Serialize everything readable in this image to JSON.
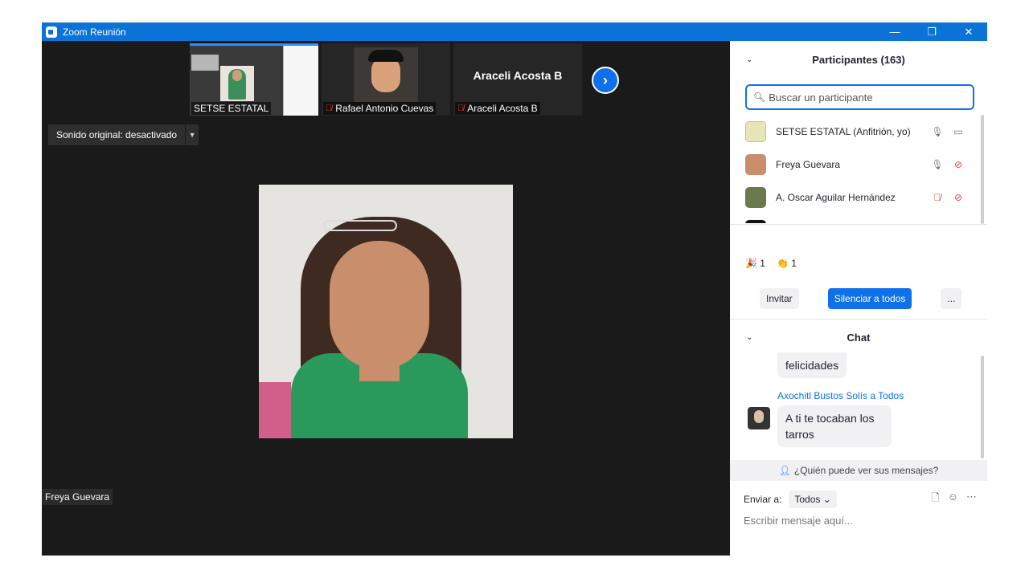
{
  "titlebar": {
    "title": "Zoom Reunión",
    "minimize": "—",
    "restore": "❐",
    "close": "✕"
  },
  "thumbnails": [
    {
      "name": "SETSE ESTATAL",
      "muted": false
    },
    {
      "name": "Rafael Antonio Cuevas",
      "muted": true
    },
    {
      "name": "Araceli Acosta B",
      "muted": true,
      "big_name": "Araceli Acosta B"
    }
  ],
  "next_button": "›",
  "sound": {
    "label": "Sonido original: desactivado",
    "dropdown": "▼"
  },
  "speaker_name": "Freya Guevara",
  "participants": {
    "header": "Participantes (163)",
    "search_placeholder": "Buscar un participante",
    "list": [
      {
        "name": "SETSE ESTATAL (Anfitrión, yo)",
        "mic_muted": false,
        "video_off": false
      },
      {
        "name": "Freya Guevara",
        "mic_muted": false,
        "video_off": true
      },
      {
        "name": "A. Oscar Aguilar Hernández",
        "mic_muted": true,
        "video_off": true
      }
    ],
    "reactions": [
      {
        "icon": "🎉",
        "count": "1"
      },
      {
        "icon": "👏",
        "count": "1"
      }
    ],
    "invite": "Invitar",
    "mute_all": "Silenciar a todos",
    "more": "..."
  },
  "chat": {
    "header": "Chat",
    "prev_message": "felicidades",
    "sender": "Axochitl Bustos Solís a Todos",
    "message": "A ti te tocaban los tarros",
    "who_can_see": "¿Quién puede ver sus mensajes?",
    "send_to_label": "Enviar a:",
    "send_to_value": "Todos",
    "input_placeholder": "Escribir mensaje aquí..."
  }
}
